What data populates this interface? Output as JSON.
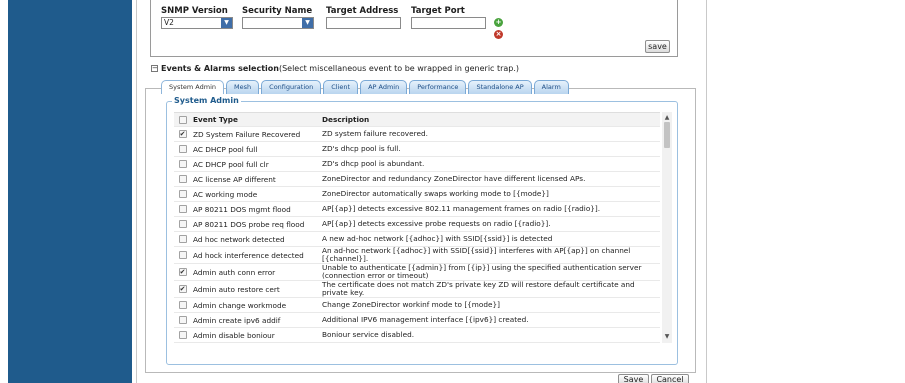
{
  "snmp": {
    "version_label": "SNMP Version",
    "version_value": "V2",
    "security_label": "Security Name",
    "security_value": "",
    "address_label": "Target Address",
    "port_label": "Target Port",
    "add_icon": "plus-icon",
    "remove_icon": "remove-icon",
    "save_label": "save"
  },
  "events": {
    "title": "Events & Alarms selection",
    "subtitle": "(Select miscellaneous event to be wrapped in generic trap.)",
    "tabs": [
      "System Admin",
      "Mesh",
      "Configuration",
      "Client",
      "AP Admin",
      "Performance",
      "Standalone AP",
      "Alarm"
    ],
    "active_tab": "System Admin",
    "legend": "System Admin",
    "columns": [
      "Event Type",
      "Description"
    ],
    "rows": [
      {
        "type": "ZD System Failure Recovered",
        "desc": "ZD system failure recovered.",
        "checked": true
      },
      {
        "type": "AC DHCP pool full",
        "desc": "ZD's dhcp pool is full.",
        "checked": false
      },
      {
        "type": "AC DHCP pool full clr",
        "desc": "ZD's dhcp pool is abundant.",
        "checked": false
      },
      {
        "type": "AC license AP different",
        "desc": "ZoneDirector and redundancy ZoneDirector have different licensed APs.",
        "checked": false
      },
      {
        "type": "AC working mode",
        "desc": "ZoneDirector automatically swaps working mode to [{mode}]",
        "checked": false
      },
      {
        "type": "AP 80211 DOS mgmt flood",
        "desc": "AP[{ap}] detects excessive 802.11 management frames on radio [{radio}].",
        "checked": false
      },
      {
        "type": "AP 80211 DOS probe req flood",
        "desc": "AP[{ap}] detects excessive probe requests on radio [{radio}].",
        "checked": false
      },
      {
        "type": "Ad hoc network detected",
        "desc": "A new ad-hoc network [{adhoc}] with SSID[{ssid}] is detected",
        "checked": false
      },
      {
        "type": "Ad hock interference detected",
        "desc": "An ad-hoc network [{adhoc}] with SSID[{ssid}] interferes with AP[{ap}] on channel [{channel}].",
        "checked": false
      },
      {
        "type": "Admin auth conn error",
        "desc": "Unable to authenticate [{admin}] from [{ip}] using the specified authentication server (connection error or timeout)",
        "checked": true
      },
      {
        "type": "Admin auto restore cert",
        "desc": "The certificate does not match ZD's private key ZD will restore default certificate and private key.",
        "checked": true
      },
      {
        "type": "Admin change workmode",
        "desc": "Change ZoneDirector workinf mode to [{mode}]",
        "checked": false
      },
      {
        "type": "Admin create ipv6 addif",
        "desc": "Additional IPV6 management interface [{ipv6}] created.",
        "checked": false
      },
      {
        "type": "Admin disable boniour",
        "desc": "Boniour service disabled.",
        "checked": false
      }
    ]
  },
  "footer": {
    "save_label": "Save",
    "cancel_label": "Cancel"
  },
  "colors": {
    "sidebar": "#1f5b8c",
    "tab_text": "#1f4f86",
    "legend": "#1f5b8c",
    "add_icon": "#4aa33e",
    "remove_icon": "#c0392b"
  }
}
